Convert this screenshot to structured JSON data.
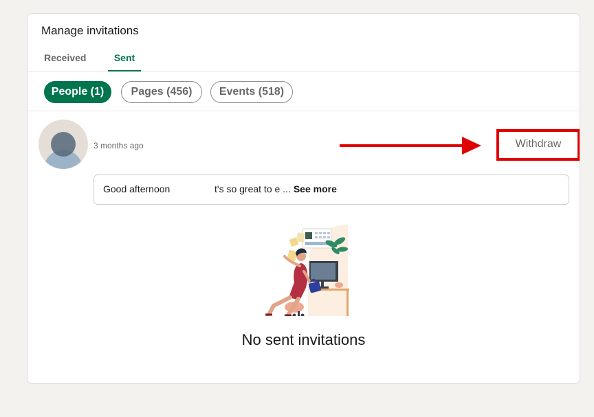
{
  "card": {
    "title": "Manage invitations",
    "tabs": [
      {
        "label": "Received",
        "selected": false
      },
      {
        "label": "Sent",
        "selected": true
      }
    ],
    "filters": [
      {
        "label": "People (1)",
        "active": true
      },
      {
        "label": "Pages (456)",
        "active": false
      },
      {
        "label": "Events (518)",
        "active": false
      }
    ]
  },
  "invitation": {
    "time": "3 months ago",
    "withdraw_label": "Withdraw",
    "message_part1": "Good afternoon",
    "message_part2": "t's so great to e ...",
    "see_more_label": "See more"
  },
  "empty_state": {
    "text": "No sent invitations"
  },
  "colors": {
    "brand_green": "#01754f",
    "annotation_red": "#e10000",
    "page_bg": "#f3f2ef"
  }
}
